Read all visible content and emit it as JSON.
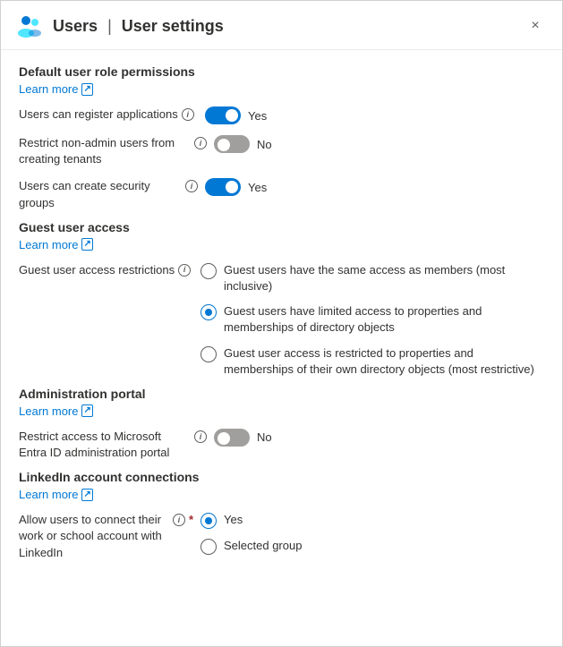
{
  "header": {
    "icon_alt": "users-icon",
    "title_prefix": "Users",
    "title_separator": "|",
    "title_suffix": "User settings",
    "close_label": "×"
  },
  "sections": {
    "default_user_role": {
      "title": "Default user role permissions",
      "learn_more_label": "Learn more",
      "settings": [
        {
          "label": "Users can register applications",
          "has_info": true,
          "toggle_state": "on",
          "toggle_value_label": "Yes"
        },
        {
          "label": "Restrict non-admin users from creating tenants",
          "has_info": true,
          "toggle_state": "off",
          "toggle_value_label": "No"
        },
        {
          "label": "Users can create security groups",
          "has_info": true,
          "toggle_state": "on",
          "toggle_value_label": "Yes"
        }
      ]
    },
    "guest_user_access": {
      "title": "Guest user access",
      "learn_more_label": "Learn more",
      "restriction_label": "Guest user access restrictions",
      "has_info": true,
      "radio_options": [
        {
          "id": "radio-guest-1",
          "text": "Guest users have the same access as members (most inclusive)",
          "selected": false
        },
        {
          "id": "radio-guest-2",
          "text": "Guest users have limited access to properties and memberships of directory objects",
          "selected": true
        },
        {
          "id": "radio-guest-3",
          "text": "Guest user access is restricted to properties and memberships of their own directory objects (most restrictive)",
          "selected": false
        }
      ]
    },
    "administration_portal": {
      "title": "Administration portal",
      "learn_more_label": "Learn more",
      "settings": [
        {
          "label": "Restrict access to Microsoft Entra ID administration portal",
          "has_info": true,
          "toggle_state": "off",
          "toggle_value_label": "No"
        }
      ]
    },
    "linkedin_connections": {
      "title": "LinkedIn account connections",
      "learn_more_label": "Learn more",
      "restriction_label": "Allow users to connect their work or school account with LinkedIn",
      "has_info": true,
      "required": true,
      "radio_options": [
        {
          "id": "radio-linkedin-1",
          "text": "Yes",
          "selected": true
        },
        {
          "id": "radio-linkedin-2",
          "text": "Selected group",
          "selected": false
        }
      ]
    }
  }
}
